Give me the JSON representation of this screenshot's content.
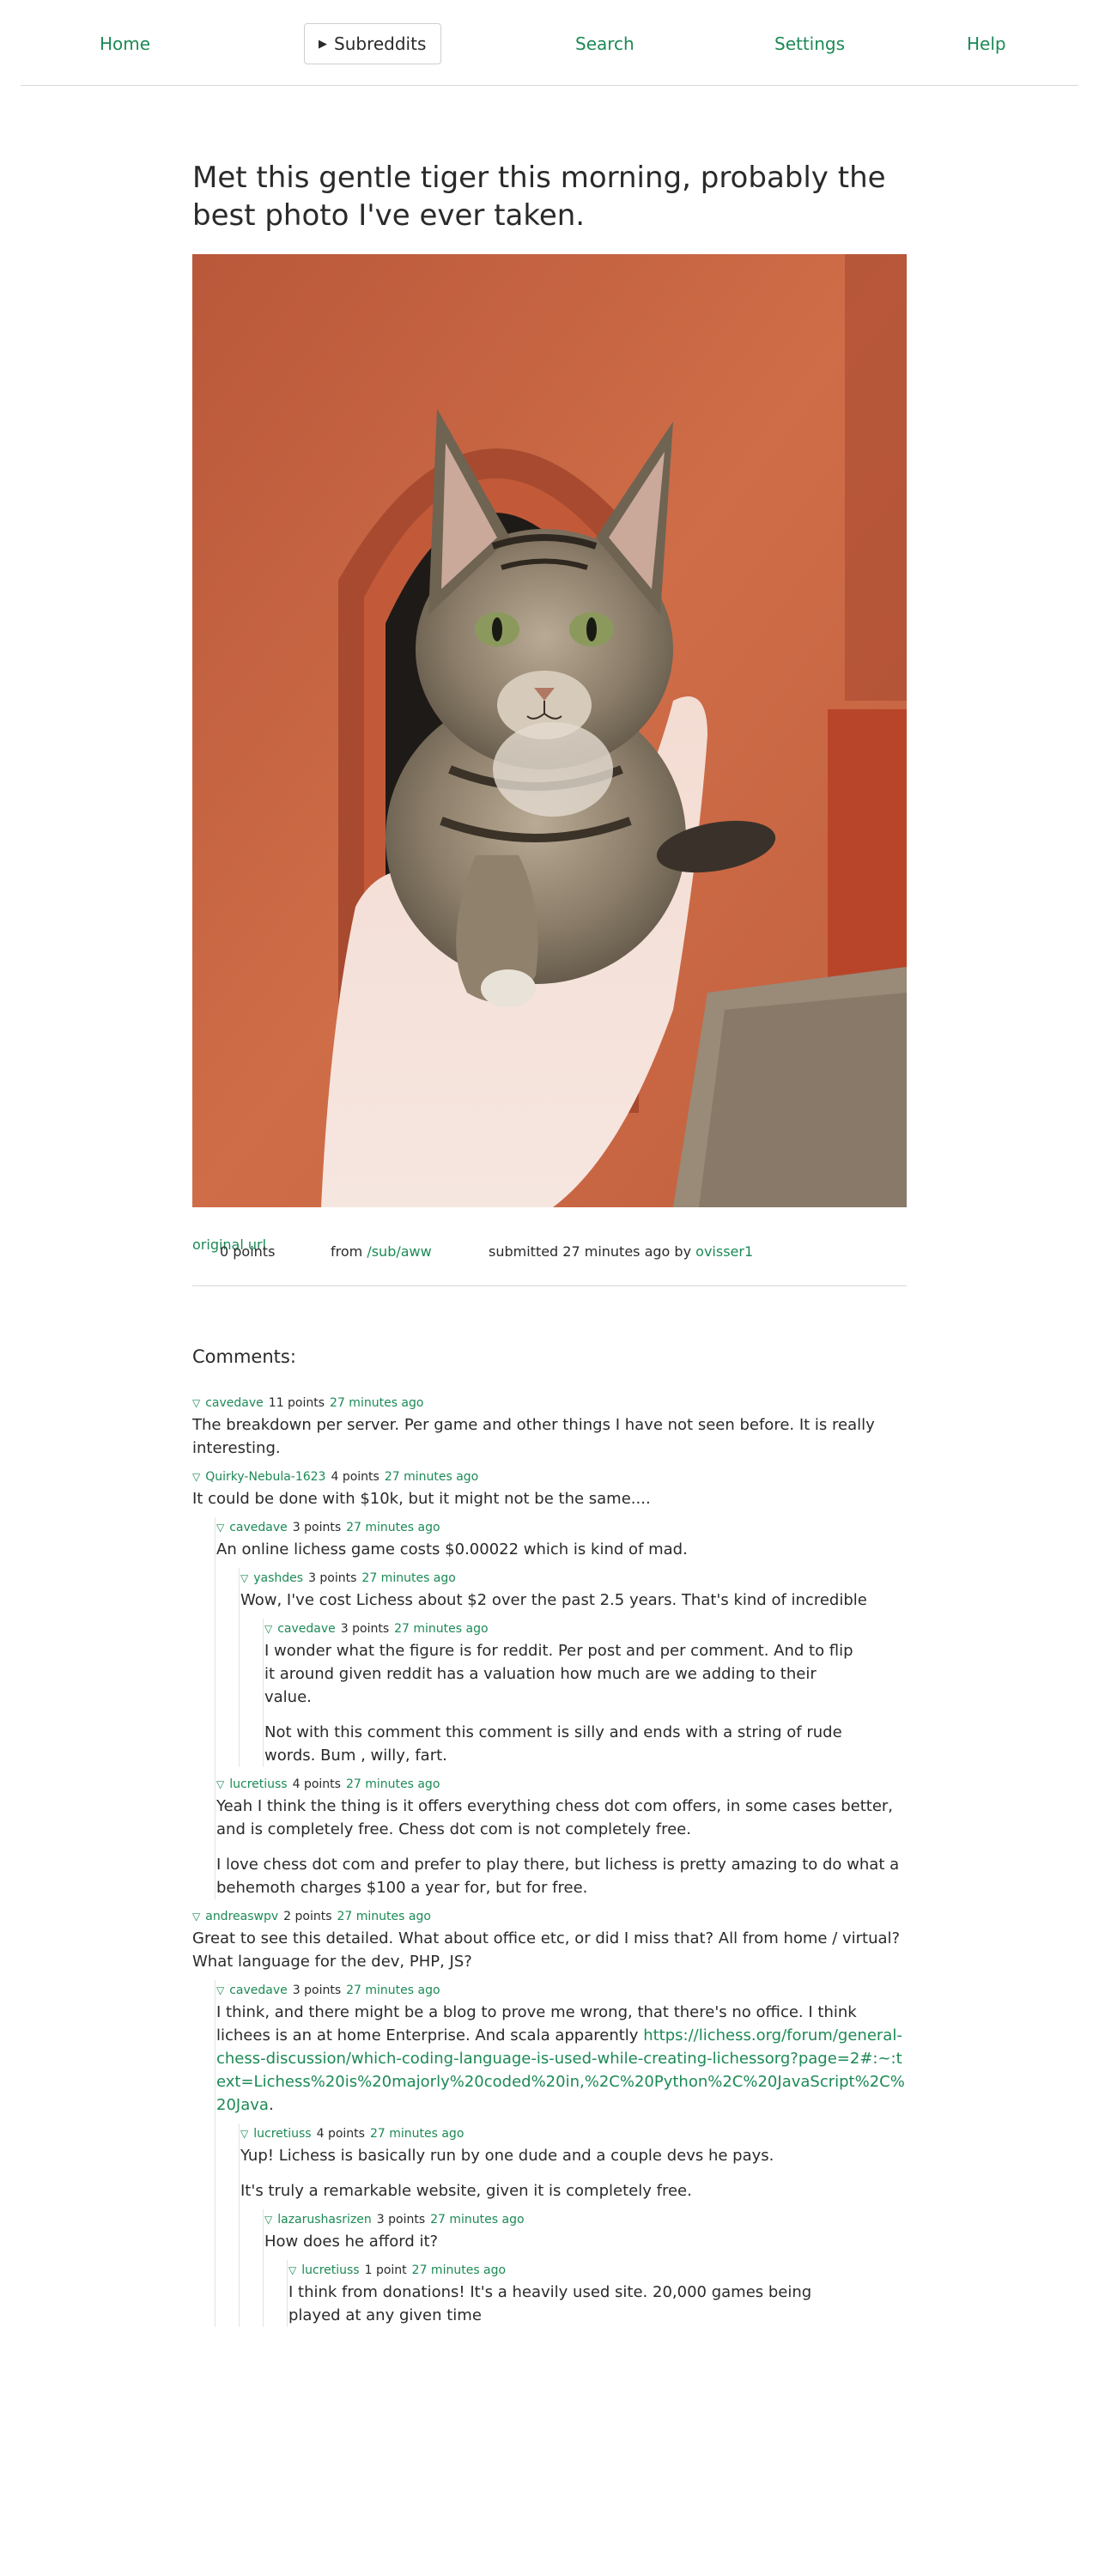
{
  "nav": {
    "home": "Home",
    "subreddits": "Subreddits",
    "search": "Search",
    "settings": "Settings",
    "help": "Help"
  },
  "post": {
    "title": "Met this gentle tiger this morning, probably the best photo I've ever taken.",
    "points": "0 points",
    "from_label": "from",
    "subreddit": "/sub/aww",
    "submitted_label": "submitted 27 minutes ago by",
    "author": "ovisser1",
    "original_url": "original url"
  },
  "comments_heading": "Comments:",
  "comments": {
    "c1": {
      "author": "cavedave",
      "points": "11 points",
      "age": "27 minutes ago",
      "p1": "The breakdown per server. Per game and other things I have not seen before. It is really interesting."
    },
    "c2": {
      "author": "Quirky-Nebula-1623",
      "points": "4 points",
      "age": "27 minutes ago",
      "p1": "It could be done with $10k, but it might not be the same...."
    },
    "c2a": {
      "author": "cavedave",
      "points": "3 points",
      "age": "27 minutes ago",
      "p1": "An online lichess game costs $0.00022 which is kind of mad."
    },
    "c2a1": {
      "author": "yashdes",
      "points": "3 points",
      "age": "27 minutes ago",
      "p1": "Wow, I've cost Lichess about $2 over the past 2.5 years. That's kind of incredible"
    },
    "c2a1a": {
      "author": "cavedave",
      "points": "3 points",
      "age": "27 minutes ago",
      "p1": "I wonder what the figure is for reddit. Per post and per comment. And to flip it around given reddit has a valuation how much are we adding to their value.",
      "p2": "Not with this comment this comment is silly and ends with a string of rude words. Bum , willy, fart."
    },
    "c2b": {
      "author": "lucretiuss",
      "points": "4 points",
      "age": "27 minutes ago",
      "p1": "Yeah I think the thing is it offers everything chess dot com offers, in some cases better, and is completely free. Chess dot com is not completely free.",
      "p2": "I love chess dot com and prefer to play there, but lichess is pretty amazing to do what a behemoth charges $100 a year for, but for free."
    },
    "c3": {
      "author": "andreaswpv",
      "points": "2 points",
      "age": "27 minutes ago",
      "p1": "Great to see this detailed. What about office etc, or did I miss that? All from home / virtual? What language for the dev, PHP, JS?"
    },
    "c3a": {
      "author": "cavedave",
      "points": "3 points",
      "age": "27 minutes ago",
      "p1": "I think, and there might be a blog to prove me wrong, that there's no office. I think lichees is an at home Enterprise. And scala apparently",
      "link": "https://lichess.org/forum/general-chess-discussion/which-coding-language-is-used-while-creating-lichessorg?page=2#:~:text=Lichess%20is%20majorly%20coded%20in,%2C%20Python%2C%20JavaScript%2C%20Java",
      "after_link": "."
    },
    "c3a1": {
      "author": "lucretiuss",
      "points": "4 points",
      "age": "27 minutes ago",
      "p1": "Yup! Lichess is basically run by one dude and a couple devs he pays.",
      "p2": "It's truly a remarkable website, given it is completely free."
    },
    "c3a1a": {
      "author": "lazarushasrizen",
      "points": "3 points",
      "age": "27 minutes ago",
      "p1": "How does he afford it?"
    },
    "c3a1a1": {
      "author": "lucretiuss",
      "points": "1 point",
      "age": "27 minutes ago",
      "p1": "I think from donations! It's a heavily used site. 20,000 games being played at any given time"
    }
  }
}
